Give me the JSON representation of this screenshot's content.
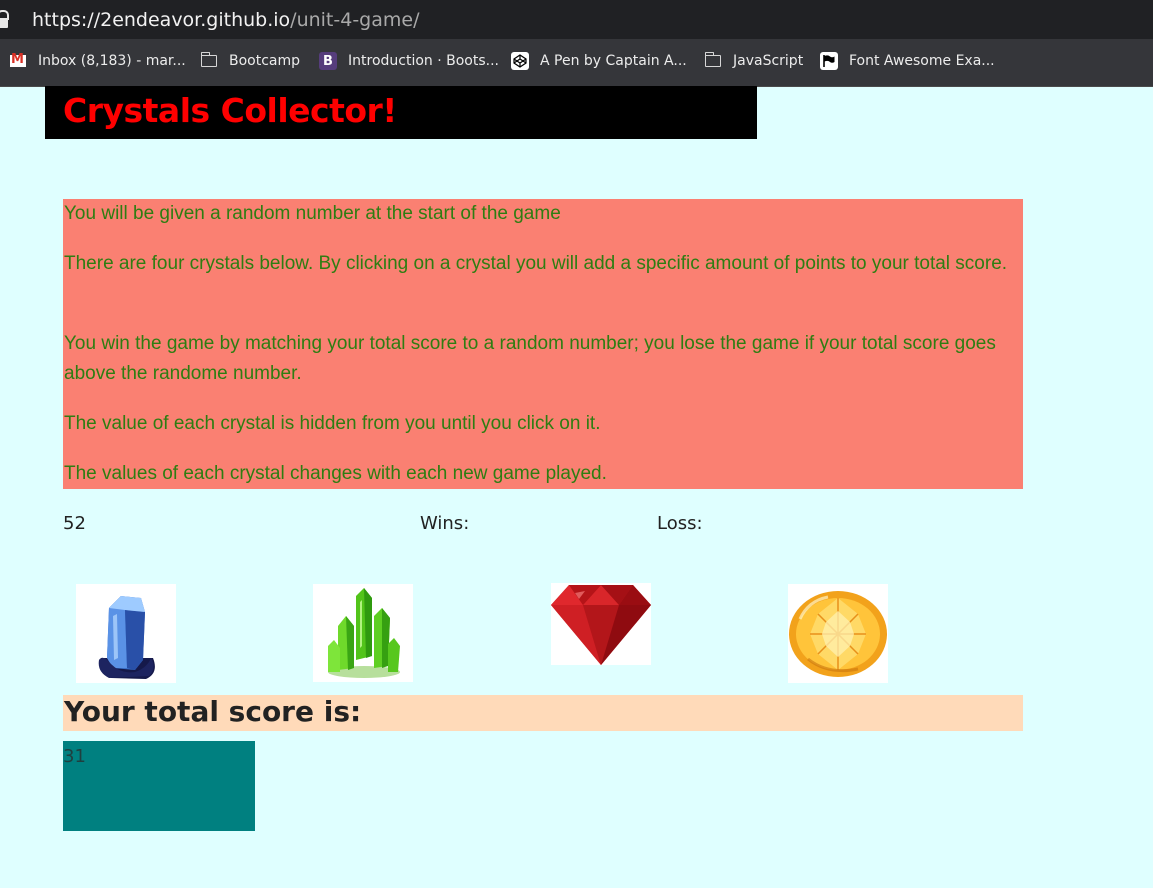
{
  "browser": {
    "url_host": "https://2endeavor.github.io",
    "url_path": "/unit-4-game/",
    "bookmarks": [
      {
        "label": "Inbox (8,183) - mar...",
        "icon": "gmail-icon"
      },
      {
        "label": "Bootcamp",
        "icon": "folder-icon"
      },
      {
        "label": "Introduction · Boots...",
        "icon": "bootstrap-icon"
      },
      {
        "label": "A Pen by Captain A...",
        "icon": "codepen-icon"
      },
      {
        "label": "JavaScript",
        "icon": "folder-icon"
      },
      {
        "label": "Font Awesome Exa...",
        "icon": "flag-icon"
      }
    ]
  },
  "page": {
    "title": "Crystals Collector!",
    "instructions": [
      "You will be given a random number at the start of the game",
      "There are four crystals below. By clicking on a crystal you will add a specific amount of points to your total score.",
      "You win the game by matching your total score to a random number; you lose the game if your total score goes above the randome number.",
      "The value of each crystal is hidden from you until you click on it.",
      "The values of each crystal changes with each new game played."
    ],
    "random_number": "52",
    "wins_label": "Wins:",
    "loss_label": "Loss:",
    "crystals": [
      {
        "name": "blue-crystal-image"
      },
      {
        "name": "green-crystal-image"
      },
      {
        "name": "red-gem-image"
      },
      {
        "name": "yellow-gem-image"
      }
    ],
    "score_heading": "Your total score is:",
    "total_score": "31"
  },
  "colors": {
    "background": "#dfffff",
    "title_bar": "#000000",
    "title_text": "#ff0000",
    "instructions_bg": "#fa8072",
    "instructions_text": "#2e7d12",
    "score_heading_bg": "#ffdab9",
    "score_box_bg": "#008080"
  }
}
